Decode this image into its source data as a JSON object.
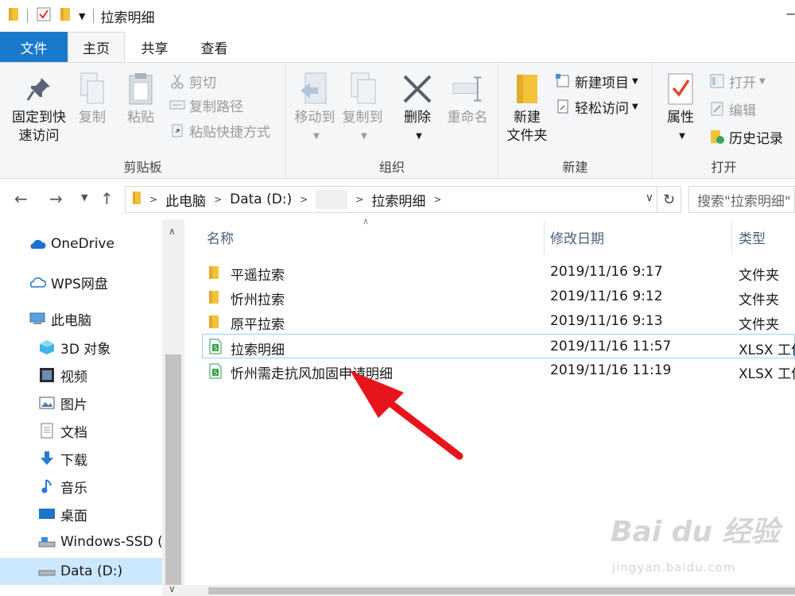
{
  "window": {
    "title": "拉索明细",
    "minimize_glyph": "−"
  },
  "ribbon_tabs": [
    {
      "label": "文件"
    },
    {
      "label": "主页"
    },
    {
      "label": "共享"
    },
    {
      "label": "查看"
    }
  ],
  "ribbon": {
    "clipboard": {
      "group_label": "剪贴板",
      "pin_line1": "固定到快",
      "pin_line2": "速访问",
      "copy": "复制",
      "paste": "粘贴",
      "cut": "剪切",
      "copy_path": "复制路径",
      "paste_shortcut": "粘贴快捷方式"
    },
    "organize": {
      "group_label": "组织",
      "move_to": "移动到",
      "copy_to": "复制到",
      "delete": "删除",
      "rename": "重命名"
    },
    "new": {
      "group_label": "新建",
      "new_folder_line1": "新建",
      "new_folder_line2": "文件夹",
      "new_item": "新建项目",
      "easy_access": "轻松访问"
    },
    "open": {
      "group_label": "打开",
      "properties": "属性",
      "open": "打开",
      "edit": "编辑",
      "history": "历史记录"
    }
  },
  "address": {
    "crumbs": [
      "此电脑",
      "Data (D:)",
      "",
      "拉索明细"
    ],
    "search_placeholder": "搜索\"拉索明细\""
  },
  "nav_pane": {
    "items": [
      {
        "label": "OneDrive",
        "icon": "cloud-icon"
      },
      {
        "label": "WPS网盘",
        "icon": "cloud-outline-icon"
      },
      {
        "label": "此电脑",
        "icon": "computer-icon"
      },
      {
        "label": "3D 对象",
        "icon": "cube-icon"
      },
      {
        "label": "视频",
        "icon": "video-icon"
      },
      {
        "label": "图片",
        "icon": "picture-icon"
      },
      {
        "label": "文档",
        "icon": "document-icon"
      },
      {
        "label": "下载",
        "icon": "download-icon"
      },
      {
        "label": "音乐",
        "icon": "music-icon"
      },
      {
        "label": "桌面",
        "icon": "desktop-icon"
      },
      {
        "label": "Windows-SSD (",
        "icon": "drive-icon"
      },
      {
        "label": "Data (D:)",
        "icon": "drive-icon"
      }
    ]
  },
  "file_list": {
    "columns": [
      "名称",
      "修改日期",
      "类型"
    ],
    "rows": [
      {
        "name": "平遥拉索",
        "date": "2019/11/16 9:17",
        "type": "文件夹",
        "icon": "folder-icon"
      },
      {
        "name": "忻州拉索",
        "date": "2019/11/16 9:12",
        "type": "文件夹",
        "icon": "folder-icon"
      },
      {
        "name": "原平拉索",
        "date": "2019/11/16 9:13",
        "type": "文件夹",
        "icon": "folder-icon"
      },
      {
        "name": "拉索明细",
        "date": "2019/11/16 11:57",
        "type": "XLSX 工作",
        "icon": "xlsx-icon"
      },
      {
        "name": "忻州需走抗风加固申请明细",
        "date": "2019/11/16 11:19",
        "type": "XLSX 工作",
        "icon": "xlsx-icon"
      }
    ]
  },
  "watermark": {
    "brand": "Bai du 经验",
    "url": "jingyan.baidu.com"
  },
  "colors": {
    "file_tab": "#1979ca",
    "ribbon_bg": "#f5f6f7",
    "selection": "#cce8ff",
    "folder": "#f2c23a",
    "xlsx": "#2e9b46",
    "annotation_arrow": "#e8141c"
  }
}
